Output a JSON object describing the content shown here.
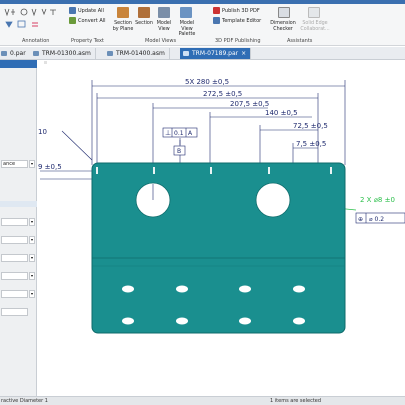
{
  "ribbon": {
    "annotation_label": "Annotation",
    "update_all": "Update All",
    "convert_all": "Convert All",
    "property_text_label": "Property Text",
    "section_by_plane": "Section by Plane",
    "section": "Section",
    "model_view": "Model View",
    "model_view_palette": "Model View Palette",
    "model_views_label": "Model Views",
    "publish_3d_pdf": "Publish 3D PDF",
    "template_editor": "Template Editor",
    "pdf_group_label": "3D PDF Publishing",
    "dimension_checker": "Dimension Checker",
    "solid_edge_label": "Solid Edge Collaborat...",
    "assistants_label": "Assistants"
  },
  "tabs": [
    {
      "label": "0.par"
    },
    {
      "label": "TRM-01300.asm"
    },
    {
      "label": "TRM-01400.asm"
    },
    {
      "label": "TRM-07189.par"
    }
  ],
  "left_panel": {
    "field_value": "ance",
    "dropdown_glyph": "▾"
  },
  "dimensions": {
    "d_5x_280": "5X  280 ±0,5",
    "d_272": "272,5 ±0,5",
    "d_207": "207,5 ±0,5",
    "d_140": "140 ±0,5",
    "d_72": "72,5 ±0,5",
    "d_7": "7,5 ±0,5",
    "d_10": "10",
    "d_9": "9 ±0,5",
    "gtol_symbol": "⊥",
    "gtol_value": "0.1",
    "gtol_datum": "A",
    "datum_b": "B",
    "hole_callout": "2 X  ⌀8 ±0",
    "position_callout": "⌀ 0.2"
  },
  "colors": {
    "part": "#1a8f8f",
    "part_edge": "#0f6b6b",
    "dim_line": "#1f2a6e",
    "selection": "#2bbf4a"
  },
  "status": {
    "left": "ractive Diameter 1",
    "right": "1 items are selected"
  }
}
